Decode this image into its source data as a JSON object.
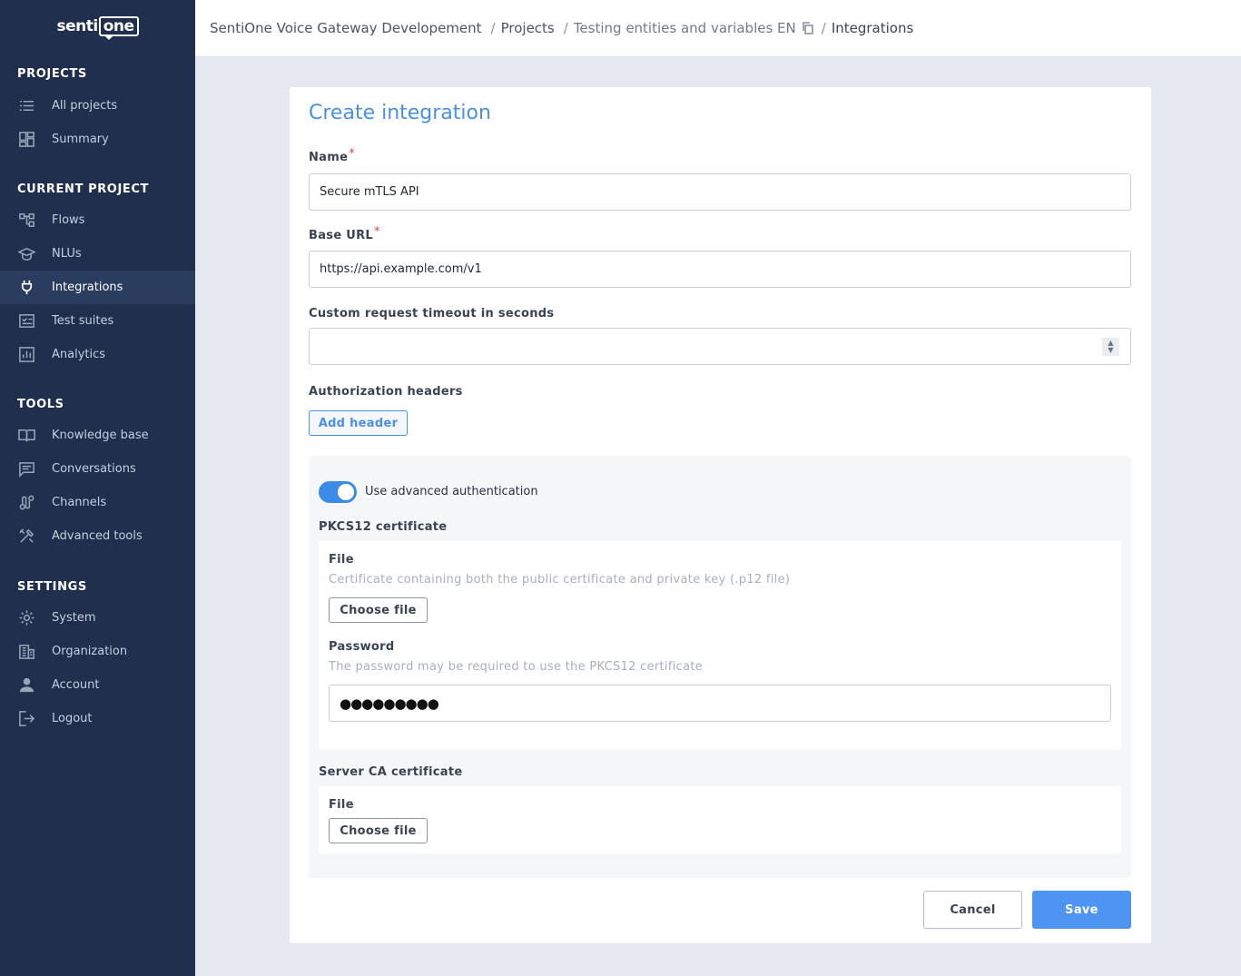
{
  "brand": {
    "logo_text_a": "senti",
    "logo_text_b": "one"
  },
  "sidebar": {
    "sections": [
      {
        "title": "PROJECTS",
        "items": [
          {
            "label": "All projects",
            "icon": "list-icon"
          },
          {
            "label": "Summary",
            "icon": "dashboard-icon"
          }
        ]
      },
      {
        "title": "CURRENT PROJECT",
        "items": [
          {
            "label": "Flows",
            "icon": "flows-icon"
          },
          {
            "label": "NLUs",
            "icon": "graduation-cap-icon"
          },
          {
            "label": "Integrations",
            "icon": "plug-icon",
            "active": true
          },
          {
            "label": "Test suites",
            "icon": "checklist-icon"
          },
          {
            "label": "Analytics",
            "icon": "bar-chart-icon"
          }
        ]
      },
      {
        "title": "TOOLS",
        "items": [
          {
            "label": "Knowledge base",
            "icon": "book-icon"
          },
          {
            "label": "Conversations",
            "icon": "chat-icon"
          },
          {
            "label": "Channels",
            "icon": "channels-icon"
          },
          {
            "label": "Advanced tools",
            "icon": "tools-icon"
          }
        ]
      },
      {
        "title": "SETTINGS",
        "items": [
          {
            "label": "System",
            "icon": "gear-icon"
          },
          {
            "label": "Organization",
            "icon": "building-icon"
          },
          {
            "label": "Account",
            "icon": "user-icon"
          },
          {
            "label": "Logout",
            "icon": "logout-icon"
          }
        ]
      }
    ]
  },
  "breadcrumb": {
    "org": "SentiOne Voice Gateway Developement",
    "projects": "Projects",
    "project": "Testing entities and variables EN",
    "current": "Integrations",
    "separator": "/"
  },
  "form": {
    "title": "Create integration",
    "name_label": "Name",
    "name_value": "Secure mTLS API",
    "required_mark": "*",
    "base_url_label": "Base URL",
    "base_url_value": "https://api.example.com/v1",
    "timeout_label": "Custom request timeout in seconds",
    "timeout_value": "",
    "auth_headers_label": "Authorization headers",
    "add_header_label": "Add header",
    "advanced": {
      "toggle_label": "Use advanced authentication",
      "toggle_on": true,
      "pkcs12_title": "PKCS12 certificate",
      "file_label": "File",
      "file_hint": "Certificate containing both the public certificate and private key (.p12 file)",
      "choose_file_label": "Choose file",
      "password_label": "Password",
      "password_hint": "The password may be required to use the PKCS12 certificate",
      "password_value": "●●●●●●●●●",
      "server_ca_title": "Server CA certificate",
      "server_file_label": "File",
      "server_choose_file_label": "Choose file"
    },
    "cancel_label": "Cancel",
    "save_label": "Save"
  },
  "colors": {
    "sidebar_bg": "#1f2f4d",
    "accent": "#4a90e2",
    "save_bg": "#4d94f3",
    "required": "#e0474c"
  }
}
